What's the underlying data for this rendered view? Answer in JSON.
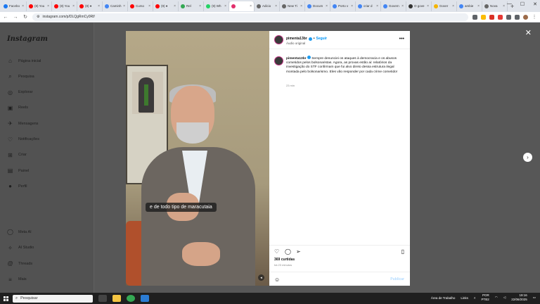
{
  "browser": {
    "tabs": [
      {
        "label": "Facebo",
        "color": "#1877f2"
      },
      {
        "label": "(8) You",
        "color": "#ff0000"
      },
      {
        "label": "(8) You",
        "color": "#ff0000"
      },
      {
        "label": "(8) ●",
        "color": "#ff0000"
      },
      {
        "label": "Caminh",
        "color": "#4285f4"
      },
      {
        "label": "Curso",
        "color": "#ff0000"
      },
      {
        "label": "(9) ●",
        "color": "#ff0000"
      },
      {
        "label": "Rel",
        "color": "#34a853"
      },
      {
        "label": "(9) Wh",
        "color": "#25d366"
      },
      {
        "label": "",
        "color": "#e1306c",
        "active": true
      },
      {
        "label": "Adicio",
        "color": "#666666"
      },
      {
        "label": "New Ti",
        "color": "#666666"
      },
      {
        "label": "Docum",
        "color": "#4285f4"
      },
      {
        "label": "Porto v",
        "color": "#4285f4"
      },
      {
        "label": "criar d",
        "color": "#4285f4"
      },
      {
        "label": "Govern",
        "color": "#4285f4"
      },
      {
        "label": "O gove",
        "color": "#333333"
      },
      {
        "label": "Gover",
        "color": "#f4b400"
      },
      {
        "label": "ambie",
        "color": "#4285f4"
      },
      {
        "label": "Nova",
        "color": "#666666"
      }
    ],
    "new_tab": "+",
    "url": "instagram.com/p/DLQgRmCy0Rf/"
  },
  "instagram": {
    "logo": "Instagram",
    "nav": [
      {
        "label": "Página inicial",
        "icon": "⌂"
      },
      {
        "label": "Pesquisa",
        "icon": "⌕"
      },
      {
        "label": "Explorar",
        "icon": "◎"
      },
      {
        "label": "Reels",
        "icon": "▣"
      },
      {
        "label": "Mensagens",
        "icon": "✈"
      },
      {
        "label": "Notificações",
        "icon": "♡"
      },
      {
        "label": "Criar",
        "icon": "⊞"
      },
      {
        "label": "Painel",
        "icon": "▤"
      },
      {
        "label": "Perfil",
        "icon": "●"
      }
    ],
    "nav_bottom": [
      {
        "label": "Meta AI",
        "icon": "◯"
      },
      {
        "label": "AI Studio",
        "icon": "✧"
      },
      {
        "label": "Threads",
        "icon": "@"
      },
      {
        "label": "Mais",
        "icon": "≡"
      }
    ]
  },
  "post": {
    "caption_overlay": "e de todo tipo de maracutaia",
    "username": "pimenta13br",
    "follow_label": "Seguir",
    "audio": "Áudio original",
    "comment_text": "Sempre denunciei os ataques à democracia e os abusos cometidos pelos bolsonaristas. Agora, as provas estão ai: relatórios da investigação do STF confirmam que fui alvo direto dessa estrutura ilegal montada pelo bolsonarismo. Eles vão responder por cada crime cometido!",
    "comment_time": "23 min",
    "likes": "369 curtidas",
    "posted_ago": "há 23 minutos",
    "publish_label": "Publicar"
  },
  "taskbar": {
    "search_placeholder": "Pesquisar",
    "tray_desktop": "Área de Trabalho",
    "tray_links": "Links",
    "lang_top": "POR",
    "lang_bottom": "PTB2",
    "time": "19:16",
    "date": "22/06/2025"
  }
}
